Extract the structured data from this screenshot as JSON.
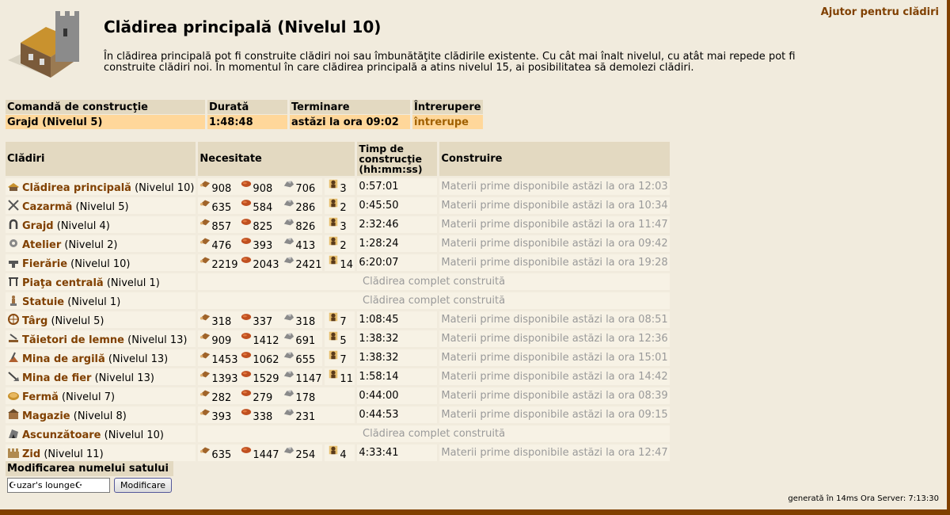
{
  "header": {
    "help_link": "Ajutor pentru clădiri",
    "title": "Clădirea principală (Nivelul 10)",
    "description": "În clădirea principală pot fi construite clădiri noi sau îmbunătăţite clădirile existente. Cu cât mai înalt nivelul, cu atât mai repede pot fi construite clădiri noi. În momentul în care clădirea principală a atins nivelul 15, ai posibilitatea să demolezi clădiri."
  },
  "queue": {
    "headers": [
      "Comandă de construcţie",
      "Durată",
      "Terminare",
      "Întrerupere"
    ],
    "row": {
      "order": "Grajd (Nivelul 5)",
      "duration": "1:48:48",
      "finish": "astăzi la ora 09:02",
      "cancel": "întrerupe"
    }
  },
  "buildings": {
    "headers": {
      "name": "Clădiri",
      "needs": "Necesitate",
      "time": "Timp de construcţie (hh:mm:ss)",
      "build": "Construire"
    },
    "rows": [
      {
        "icon": "main-building-icon",
        "name": "Clădirea principală",
        "level": "(Nivelul 10)",
        "wood": "908",
        "clay": "908",
        "iron": "706",
        "pop": "3",
        "time": "0:57:01",
        "build": "Materii prime disponibile astăzi la ora 12:03"
      },
      {
        "icon": "barracks-icon",
        "name": "Cazarmă",
        "level": "(Nivelul 5)",
        "wood": "635",
        "clay": "584",
        "iron": "286",
        "pop": "2",
        "time": "0:45:50",
        "build": "Materii prime disponibile astăzi la ora 10:34"
      },
      {
        "icon": "stable-icon",
        "name": "Grajd",
        "level": "(Nivelul 4)",
        "wood": "857",
        "clay": "825",
        "iron": "826",
        "pop": "3",
        "time": "2:32:46",
        "build": "Materii prime disponibile astăzi la ora 11:47"
      },
      {
        "icon": "workshop-icon",
        "name": "Atelier",
        "level": "(Nivelul 2)",
        "wood": "476",
        "clay": "393",
        "iron": "413",
        "pop": "2",
        "time": "1:28:24",
        "build": "Materii prime disponibile astăzi la ora 09:42"
      },
      {
        "icon": "smithy-icon",
        "name": "Fierărie",
        "level": "(Nivelul 10)",
        "wood": "2219",
        "clay": "2043",
        "iron": "2421",
        "pop": "14",
        "time": "6:20:07",
        "build": "Materii prime disponibile astăzi la ora 19:28"
      },
      {
        "icon": "place-icon",
        "name": "Piaţa centrală",
        "level": "(Nivelul 1)",
        "complete": "Clădirea complet construită"
      },
      {
        "icon": "statue-icon",
        "name": "Statuie",
        "level": "(Nivelul 1)",
        "complete": "Clădirea complet construită"
      },
      {
        "icon": "market-icon",
        "name": "Târg",
        "level": "(Nivelul 5)",
        "wood": "318",
        "clay": "337",
        "iron": "318",
        "pop": "7",
        "time": "1:08:45",
        "build": "Materii prime disponibile astăzi la ora 08:51"
      },
      {
        "icon": "timber-camp-icon",
        "name": "Tăietori de lemne",
        "level": "(Nivelul 13)",
        "wood": "909",
        "clay": "1412",
        "iron": "691",
        "pop": "5",
        "time": "1:38:32",
        "build": "Materii prime disponibile astăzi la ora 12:36"
      },
      {
        "icon": "clay-pit-icon",
        "name": "Mina de argilă",
        "level": "(Nivelul 13)",
        "wood": "1453",
        "clay": "1062",
        "iron": "655",
        "pop": "7",
        "time": "1:38:32",
        "build": "Materii prime disponibile astăzi la ora 15:01"
      },
      {
        "icon": "iron-mine-icon",
        "name": "Mina de fier",
        "level": "(Nivelul 13)",
        "wood": "1393",
        "clay": "1529",
        "iron": "1147",
        "pop": "11",
        "time": "1:58:14",
        "build": "Materii prime disponibile astăzi la ora 14:42"
      },
      {
        "icon": "farm-icon",
        "name": "Fermă",
        "level": "(Nivelul 7)",
        "wood": "282",
        "clay": "279",
        "iron": "178",
        "pop": "",
        "time": "0:44:00",
        "build": "Materii prime disponibile astăzi la ora 08:39"
      },
      {
        "icon": "storage-icon",
        "name": "Magazie",
        "level": "(Nivelul 8)",
        "wood": "393",
        "clay": "338",
        "iron": "231",
        "pop": "",
        "time": "0:44:53",
        "build": "Materii prime disponibile astăzi la ora 09:15"
      },
      {
        "icon": "hiding-place-icon",
        "name": "Ascunzătoare",
        "level": "(Nivelul 10)",
        "complete": "Clădirea complet construită"
      },
      {
        "icon": "wall-icon",
        "name": "Zid",
        "level": "(Nivelul 11)",
        "wood": "635",
        "clay": "1447",
        "iron": "254",
        "pop": "4",
        "time": "4:33:41",
        "build": "Materii prime disponibile astăzi la ora 12:47"
      }
    ]
  },
  "rename": {
    "header": "Modificarea numelui satului",
    "value": "☪uzar's lounge☪",
    "button": "Modificare"
  },
  "footer": "generată în 14ms Ora Server: 7:13:30",
  "colors": {
    "link": "#804000",
    "queue_row": "#ffd79a",
    "header_bg": "#e3d9c1",
    "page_bg": "#f1ebdd",
    "frame": "#804000"
  }
}
